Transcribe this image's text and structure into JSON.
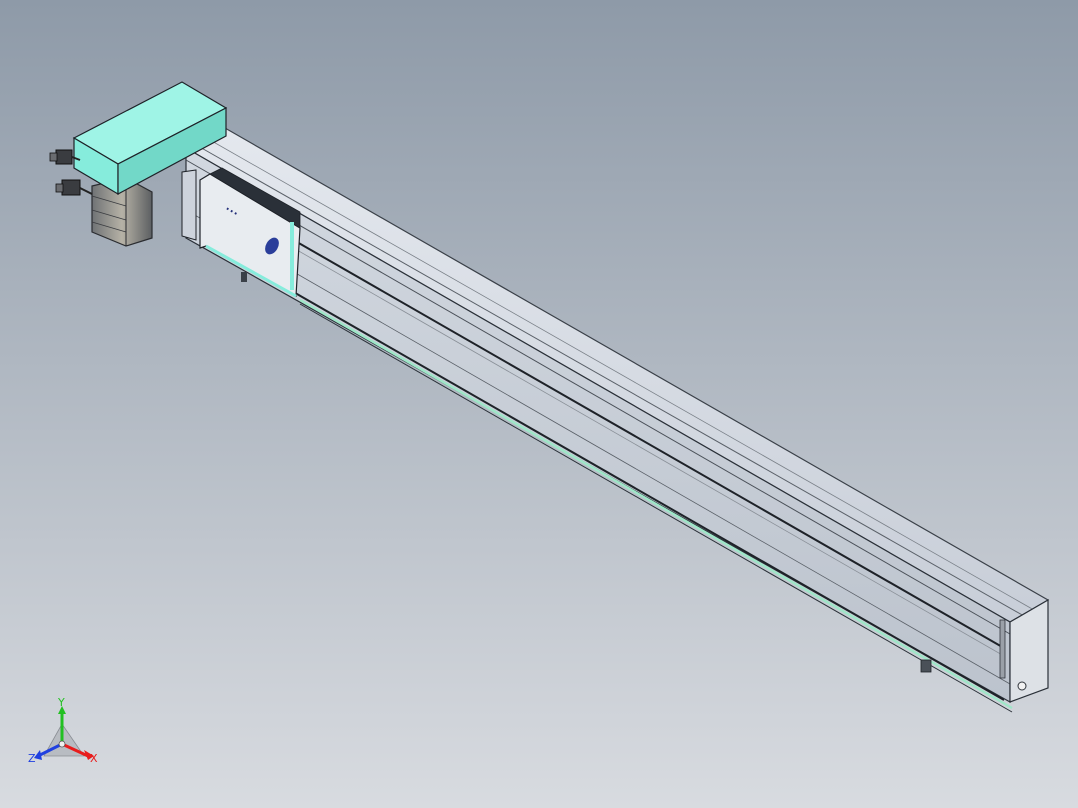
{
  "viewport": {
    "background_top": "#8e9aa8",
    "background_bottom": "#d8dbe0"
  },
  "model": {
    "colors": {
      "motor_housing": "#86ecdc",
      "rail_body": "#cdd3dc",
      "rail_edge": "#2a3038",
      "accent_green": "#9fe6c8"
    },
    "carriage_logo": "..."
  },
  "triad": {
    "x_label": "X",
    "y_label": "Y",
    "z_label": "Z",
    "x_color": "#e81c1c",
    "y_color": "#22c022",
    "z_color": "#2040e0"
  }
}
